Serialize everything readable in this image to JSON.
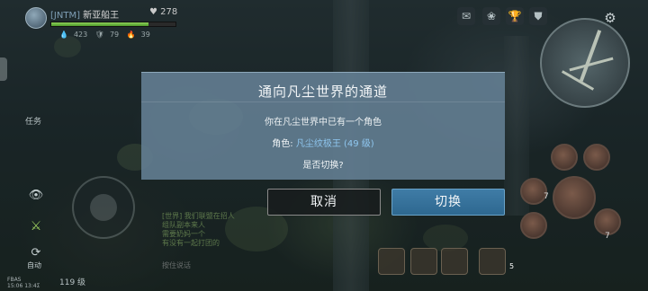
{
  "player": {
    "guild": "[JNTM]",
    "name": "新亚船王",
    "power_icon": "heart-icon",
    "power": "278",
    "hp_fraction": 0.78,
    "stats": [
      "423",
      "79",
      "39"
    ]
  },
  "hud": {
    "quest_label": "任务",
    "auto_label": "自动",
    "fps_line1": "FBAS",
    "fps_line2": "15:06 13:4Σ",
    "level_label": "119 级",
    "chat_lines": [
      "[世界] 我们联盟在招人",
      "组队副本来人",
      "需要奶妈一个",
      "有没有一起打团的"
    ],
    "chat_hint": "按住说话",
    "skill_cd": [
      "7",
      "7"
    ],
    "quick_count": "5"
  },
  "dialog": {
    "title": "通向凡尘世界的通道",
    "message": "你在凡尘世界中已有一个角色",
    "role_prefix": "角色:",
    "role_value": "凡尘纹极王 (49 级)",
    "question": "是否切换?",
    "cancel_label": "取消",
    "confirm_label": "切换"
  },
  "colors": {
    "dialog_bg": "#617c8f",
    "confirm_bg": "#3a76a0",
    "role_value": "#8fc7f0",
    "hp": "#6db540"
  }
}
